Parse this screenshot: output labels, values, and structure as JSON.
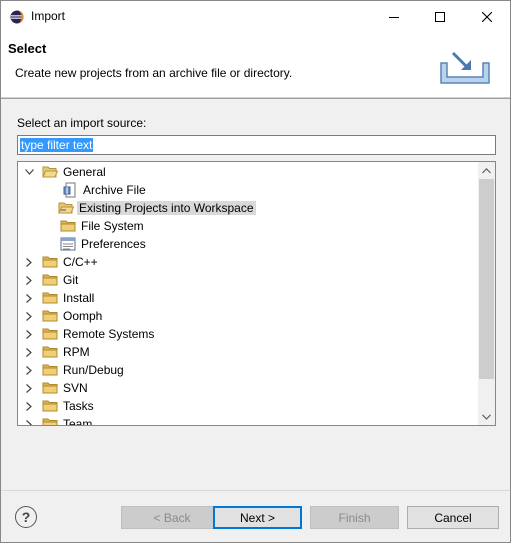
{
  "window": {
    "title": "Import"
  },
  "banner": {
    "title": "Select",
    "description": "Create new projects from an archive file or directory."
  },
  "source_label": "Select an import source:",
  "filter": {
    "value": "type filter text"
  },
  "tree": [
    {
      "label": "General",
      "expanded": true,
      "icon": "folder-open-icon",
      "depth": 0
    },
    {
      "label": "Archive File",
      "icon": "archive-file-icon",
      "depth": 1
    },
    {
      "label": "Existing Projects into Workspace",
      "icon": "existing-projects-icon",
      "depth": 1,
      "selected": true
    },
    {
      "label": "File System",
      "icon": "folder-icon",
      "depth": 1
    },
    {
      "label": "Preferences",
      "icon": "preferences-icon",
      "depth": 1
    },
    {
      "label": "C/C++",
      "icon": "folder-icon",
      "depth": 0
    },
    {
      "label": "Git",
      "icon": "folder-icon",
      "depth": 0
    },
    {
      "label": "Install",
      "icon": "folder-icon",
      "depth": 0
    },
    {
      "label": "Oomph",
      "icon": "folder-icon",
      "depth": 0
    },
    {
      "label": "Remote Systems",
      "icon": "folder-icon",
      "depth": 0
    },
    {
      "label": "RPM",
      "icon": "folder-icon",
      "depth": 0
    },
    {
      "label": "Run/Debug",
      "icon": "folder-icon",
      "depth": 0
    },
    {
      "label": "SVN",
      "icon": "folder-icon",
      "depth": 0
    },
    {
      "label": "Tasks",
      "icon": "folder-icon",
      "depth": 0
    },
    {
      "label": "Team",
      "icon": "folder-icon",
      "depth": 0
    }
  ],
  "buttons": {
    "help": "?",
    "back": "< Back",
    "next": "Next >",
    "finish": "Finish",
    "cancel": "Cancel"
  },
  "colors": {
    "selection": "#3399ff",
    "accent": "#0078d7",
    "folder": "#dcb35c"
  }
}
